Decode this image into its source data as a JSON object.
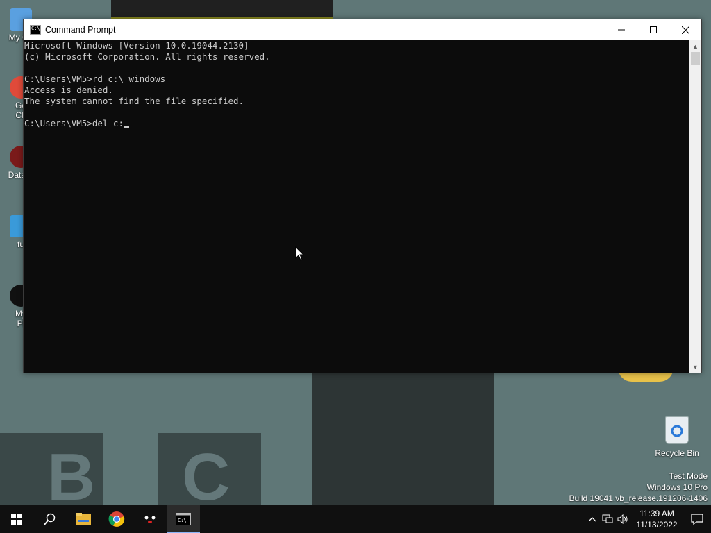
{
  "window": {
    "title": "Command Prompt",
    "minimize_icon": "minimize-icon",
    "maximize_icon": "maximize-icon",
    "close_icon": "close-icon"
  },
  "console": {
    "lines": [
      "Microsoft Windows [Version 10.0.19044.2130]",
      "(c) Microsoft Corporation. All rights reserved.",
      "",
      "C:\\Users\\VM5>rd c:\\ windows",
      "Access is denied.",
      "The system cannot find the file specified.",
      "",
      "C:\\Users\\VM5>del c:"
    ],
    "background": "#0c0c0c",
    "foreground": "#cccccc"
  },
  "desktop": {
    "partial_labels": [
      "My Co",
      "Go",
      "Ch",
      "DataW",
      "fu",
      "My",
      "Pi"
    ],
    "recycle_bin": "Recycle Bin"
  },
  "watermark": {
    "line1": "Test Mode",
    "line2": "Windows 10 Pro",
    "line3": "Build 19041.vb_release.191206-1406"
  },
  "taskbar": {
    "apps": [
      "start-icon",
      "search-icon",
      "file-explorer-icon",
      "chrome-icon",
      "app-icon",
      "command-prompt-icon"
    ],
    "time": "11:39 AM",
    "date": "11/13/2022"
  }
}
